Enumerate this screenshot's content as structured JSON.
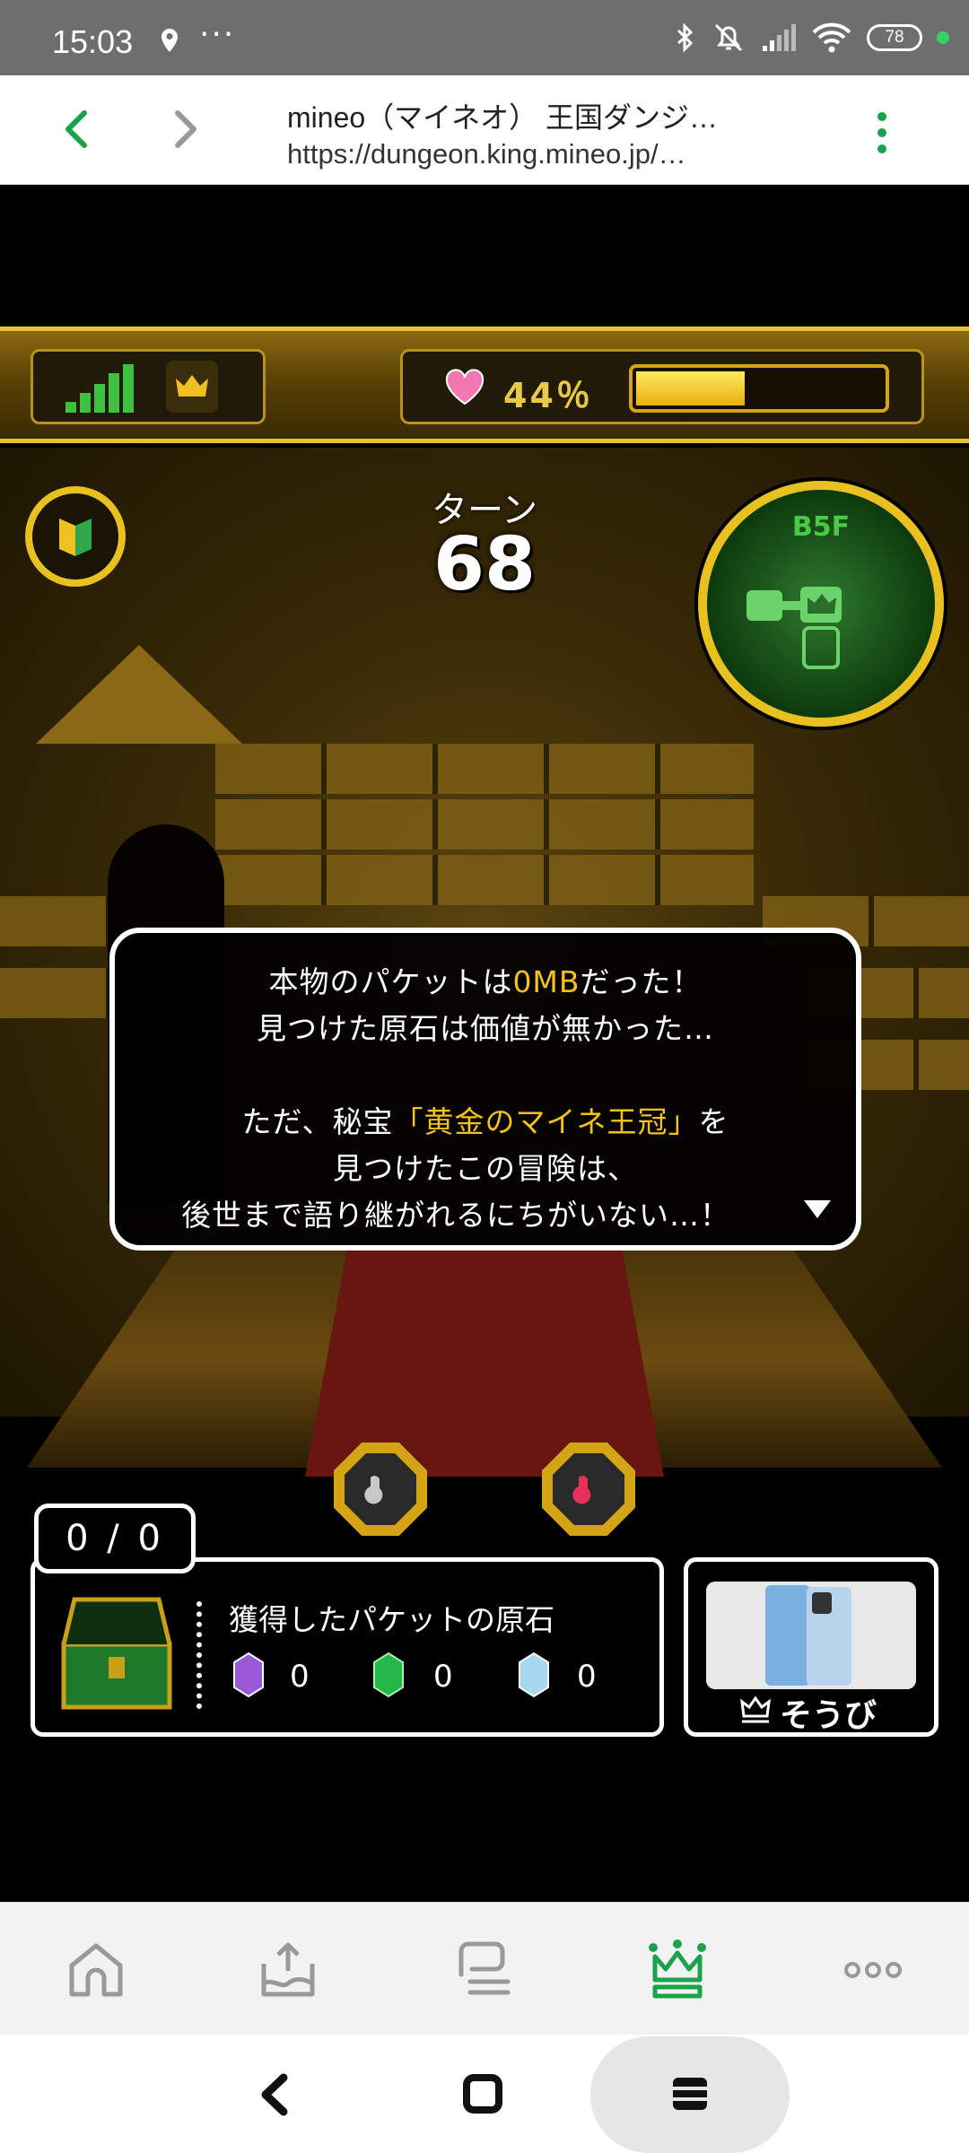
{
  "status_bar": {
    "time": "15:03",
    "more": "···",
    "battery": "78"
  },
  "browser": {
    "title": "mineo（マイネオ） 王国ダンジ…",
    "url": "https://dungeon.king.mineo.jp/…"
  },
  "game": {
    "hp_percent_label": "44％",
    "hp_level": 0.44,
    "turn_label": "ターン",
    "turn_number": "68",
    "floor": "B5F",
    "message": {
      "line1_a": "本物のパケットは",
      "line1_b": "0MB",
      "line1_c": "だった！",
      "line2": "見つけた原石は価値が無かった…",
      "line3_a": "ただ、秘宝",
      "line3_b": "「黄金のマイネ王冠」",
      "line3_c": "を",
      "line4": "見つけたこの冒険は、",
      "line5": "後世まで語り継がれるにちがいない…！"
    },
    "counter": "0 / 0",
    "stones": {
      "title": "獲得したパケットの原石",
      "purple": "0",
      "green": "0",
      "blue": "0"
    },
    "equip_label": "そうび"
  },
  "colors": {
    "accent_green": "#1aa34a",
    "gold": "#e8c020",
    "message_highlight": "#f4c21c"
  }
}
